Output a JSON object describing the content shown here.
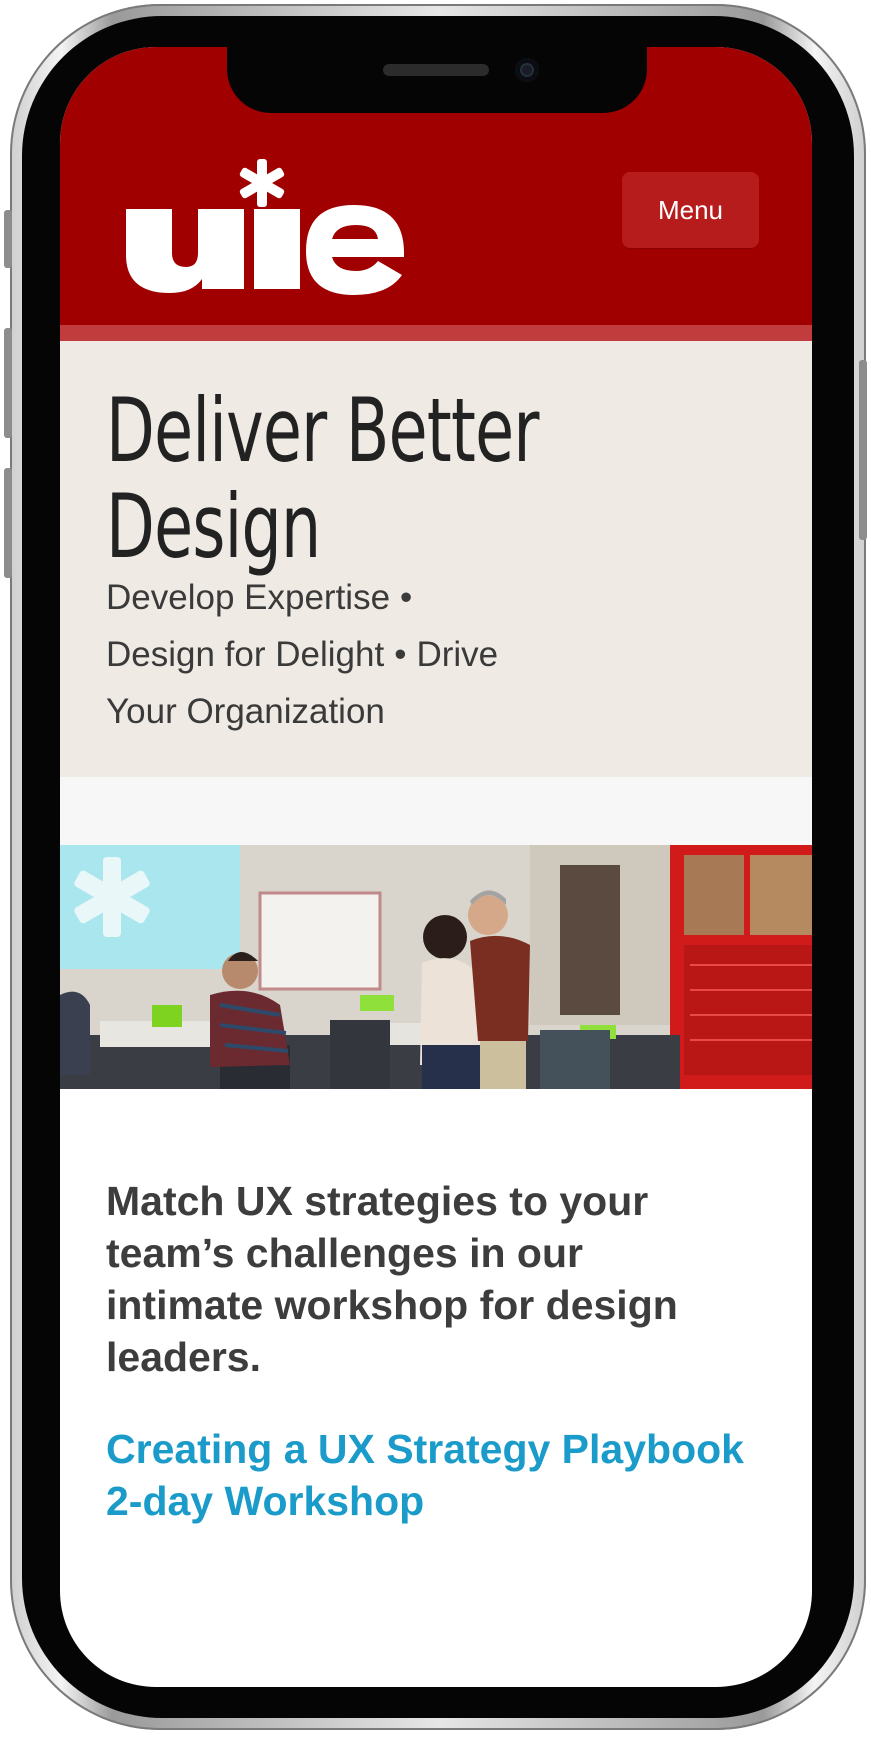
{
  "header": {
    "logo_text": "uie",
    "menu_label": "Menu",
    "brand_color": "#a00000"
  },
  "hero": {
    "title_line1": "Deliver Better",
    "title_line2": "Design",
    "tag1": "Develop Expertise",
    "tag2": "Design for Delight",
    "tag3": "Drive",
    "tag3b": "Your Organization",
    "separator": "•"
  },
  "main": {
    "description": "Match UX strategies to your team’s challenges in our intimate workshop for design leaders.",
    "cta_line1": "Creating a UX Strategy Playbook",
    "cta_line2": "2-day Workshop",
    "link_color": "#1a9bc9"
  }
}
